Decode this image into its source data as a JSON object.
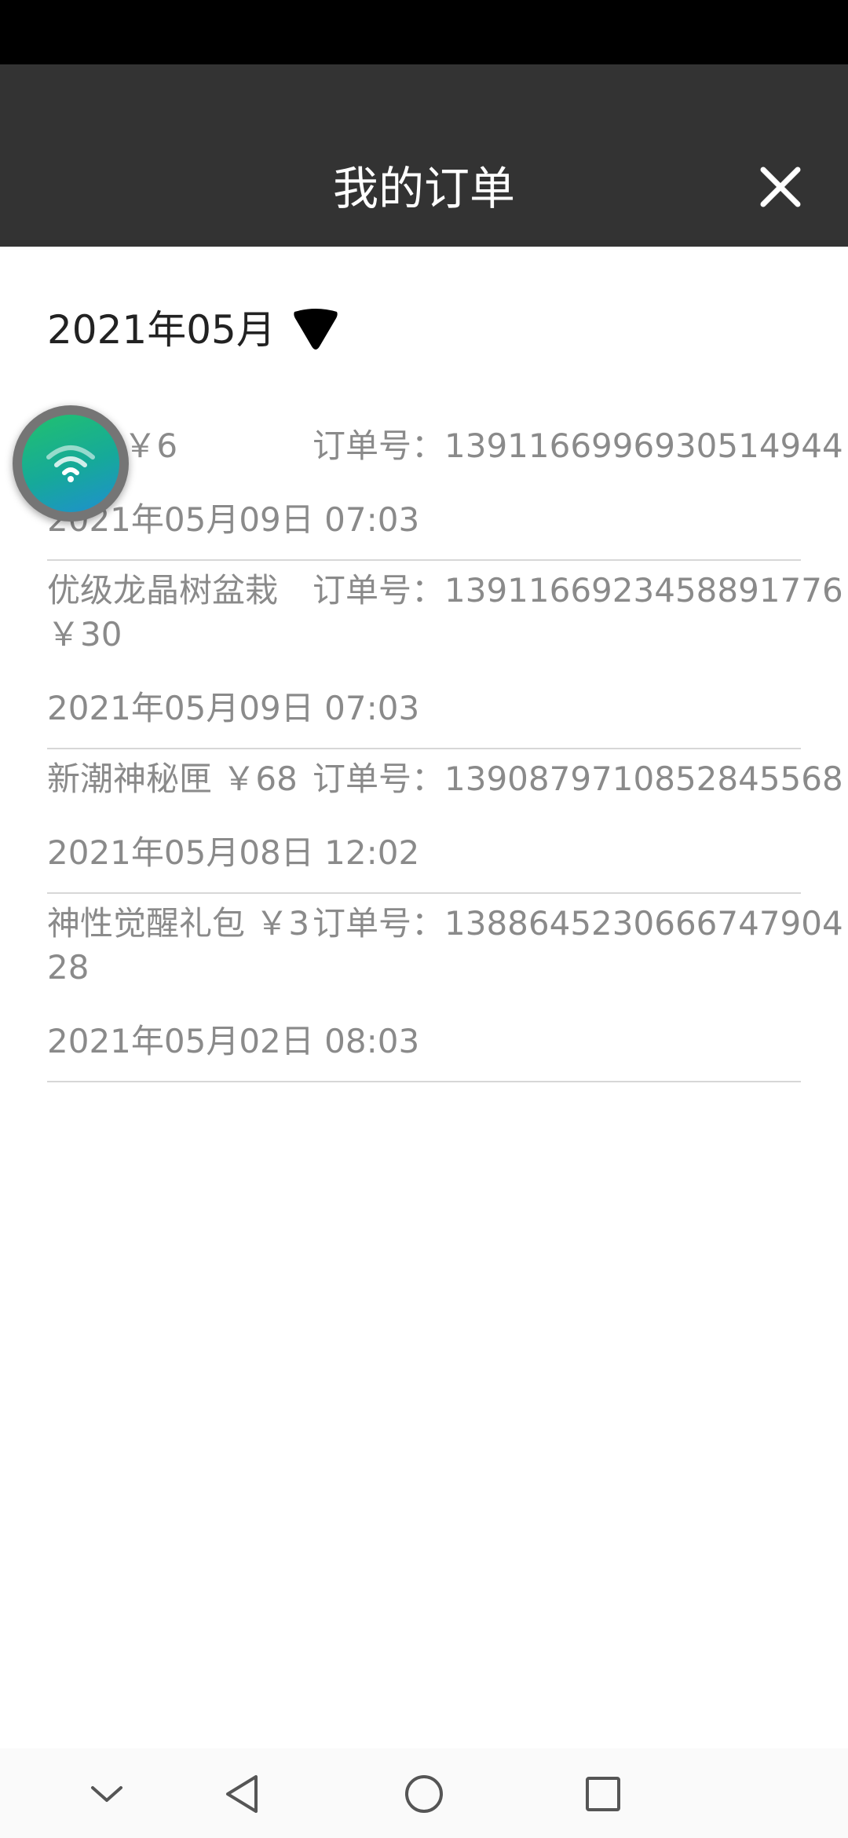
{
  "header": {
    "title": "我的订单",
    "close_icon": "close-icon"
  },
  "filter": {
    "month": "2021年05月",
    "dropdown_icon": "triangle-down-icon"
  },
  "orders": [
    {
      "name": "龙晶 ￥6",
      "order_no": "订单号：1391166996930514944",
      "date": "2021年05月09日 07:03"
    },
    {
      "name": "优级龙晶树盆栽 ￥30",
      "order_no": "订单号：1391166923458891776",
      "date": "2021年05月09日 07:03"
    },
    {
      "name": "新潮神秘匣 ￥68",
      "order_no": "订单号：1390879710852845568",
      "date": "2021年05月08日 12:02"
    },
    {
      "name": "神性觉醒礼包 ￥328",
      "order_no": "订单号：1388645230666747904",
      "date": "2021年05月02日 08:03"
    }
  ],
  "floating_button": {
    "icon": "wifi-icon"
  },
  "nav": {
    "icons": [
      "chevron-down-icon",
      "back-triangle-icon",
      "home-circle-icon",
      "recents-square-icon"
    ]
  },
  "colors": {
    "header_bg": "#333333",
    "text_secondary": "#8a8a8a",
    "float_gradient_start": "#21c16e",
    "float_gradient_end": "#1f8fd0"
  }
}
